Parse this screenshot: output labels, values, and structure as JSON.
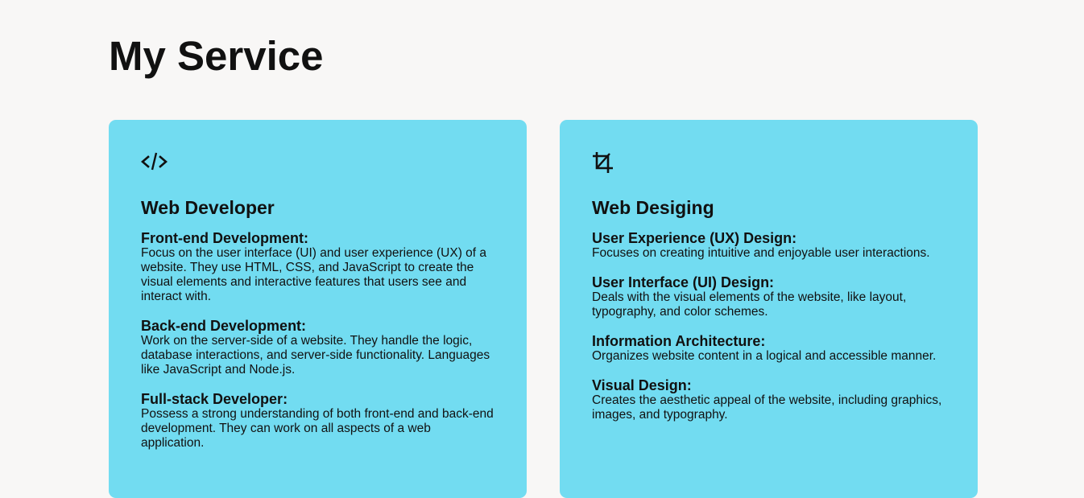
{
  "page": {
    "title": "My Service"
  },
  "colors": {
    "background": "#f8f7f6",
    "card": "#72dcf1",
    "text": "#111111"
  },
  "cards": [
    {
      "icon": "code-icon",
      "title": "Web Developer",
      "items": [
        {
          "title": "Front-end Development:",
          "desc": "Focus on the user interface (UI) and user experience (UX) of a website. They use HTML, CSS, and JavaScript to create the visual elements and interactive features that users see and interact with."
        },
        {
          "title": "Back-end Development:",
          "desc": "Work on the server-side of a website. They handle the logic, database interactions, and server-side functionality. Languages like JavaScript and Node.js."
        },
        {
          "title": "Full-stack Developer:",
          "desc": "Possess a strong understanding of both front-end and back-end development. They can work on all aspects of a web application."
        }
      ]
    },
    {
      "icon": "crop-icon",
      "title": "Web Desiging",
      "items": [
        {
          "title": "User Experience (UX) Design:",
          "desc": "Focuses on creating intuitive and enjoyable user interactions."
        },
        {
          "title": "User Interface (UI) Design:",
          "desc": "Deals with the visual elements of the website, like layout, typography, and color schemes."
        },
        {
          "title": "Information Architecture:",
          "desc": "Organizes website content in a logical and accessible manner."
        },
        {
          "title": "Visual Design:",
          "desc": "Creates the aesthetic appeal of the website, including graphics, images, and typography."
        }
      ]
    }
  ]
}
